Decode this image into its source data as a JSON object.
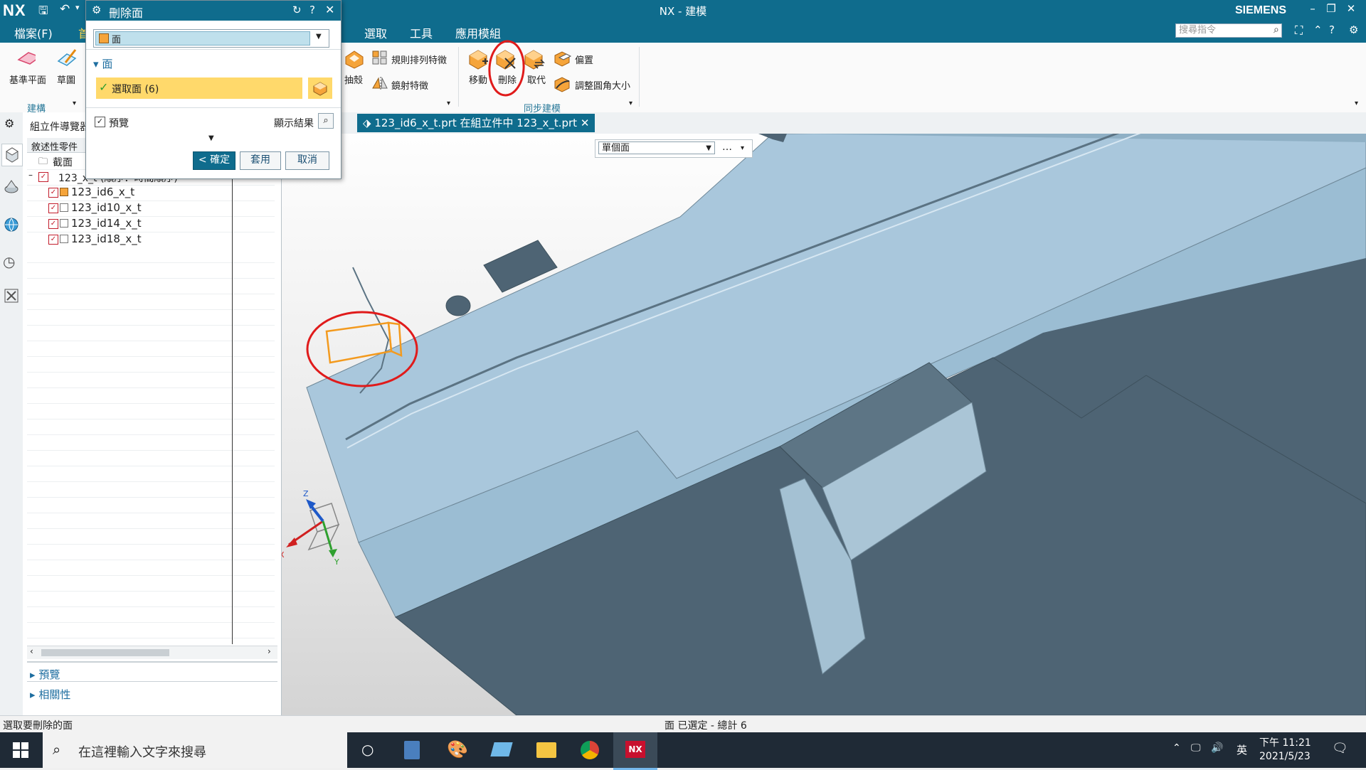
{
  "app": {
    "logo": "NX",
    "title": "NX - 建模",
    "brand": "SIEMENS",
    "window_controls": [
      "–",
      "❐",
      "✕"
    ]
  },
  "menu": {
    "items": [
      "檔案(F)",
      "首",
      "選取",
      "工具",
      "應用模組"
    ],
    "search_placeholder": "搜尋指令"
  },
  "ribbon": {
    "left_tools": [
      {
        "label": "基準平面",
        "icon": "datum-plane-icon"
      },
      {
        "label": "草圖",
        "icon": "sketch-icon"
      }
    ],
    "left_group": "建構",
    "feature_tools": [
      {
        "label": "抽殼",
        "icon": "shell-icon"
      },
      {
        "label": "規則排列特徵",
        "icon": "pattern-feature-icon"
      },
      {
        "label": "鏡射特徵",
        "icon": "mirror-feature-icon"
      }
    ],
    "sync_tools": [
      {
        "label": "移動",
        "icon": "move-face-icon"
      },
      {
        "label": "刪除",
        "icon": "delete-face-icon"
      },
      {
        "label": "取代",
        "icon": "replace-face-icon"
      },
      {
        "label": "偏置",
        "icon": "offset-face-icon"
      },
      {
        "label": "調整圓角大小",
        "icon": "resize-blend-icon"
      }
    ],
    "sync_group": "同步建模"
  },
  "dialog": {
    "title": "刪除面",
    "type_value": "面",
    "section_title": "面",
    "selection_label": "選取面 (6)",
    "preview_label": "預覽",
    "preview_checked": true,
    "show_result": "顯示結果",
    "ok": "< 確定 >",
    "apply": "套用",
    "cancel": "取消"
  },
  "navigator": {
    "title": "組立件導覽器",
    "column_header": "敘述性零件",
    "section_node": "截面",
    "root_node": "123_x_t (順序：時間順序)",
    "children": [
      "123_id6_x_t",
      "123_id10_x_t",
      "123_id14_x_t",
      "123_id18_x_t"
    ],
    "bottom_sections": [
      "預覽",
      "相關性"
    ]
  },
  "graphics": {
    "tab_label": "123_id6_x_t.prt 在組立件中 123_x_t.prt",
    "filter_value": "單個面",
    "filter_more": "…",
    "triad_labels": {
      "x": "X",
      "y": "Y",
      "z": "Z"
    }
  },
  "status": {
    "left": "選取要刪除的面",
    "center": "面 已選定 - 總計 6"
  },
  "taskbar": {
    "search_placeholder": "在這裡輸入文字來搜尋",
    "ime": "英",
    "time": "下午 11:21",
    "date": "2021/5/23"
  },
  "colors": {
    "title_blue": "#0f6c8d",
    "part_face": "#a9c7dc",
    "part_dark": "#4e6474",
    "highlight_orange": "#f39a1e",
    "annotation_red": "#e01b1b"
  }
}
